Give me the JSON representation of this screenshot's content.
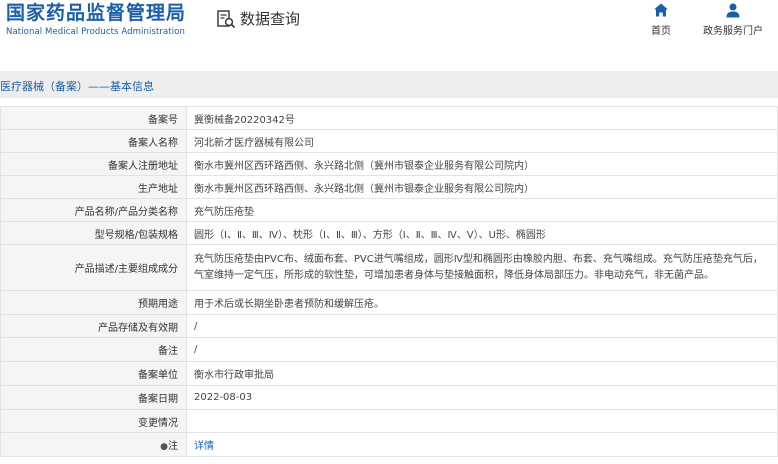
{
  "header": {
    "logo_cn": "国家药品监督管理局",
    "logo_en": "National Medical Products Administration",
    "query_label": "数据查询",
    "nav": [
      {
        "label": "首页",
        "icon": "home-icon"
      },
      {
        "label": "政务服务门户",
        "icon": "user-icon"
      }
    ]
  },
  "section": {
    "title": "医疗器械（备案）——基本信息"
  },
  "rows": [
    {
      "label": "备案号",
      "value": "冀衡械备20220342号"
    },
    {
      "label": "备案人名称",
      "value": "河北新才医疗器械有限公司"
    },
    {
      "label": "备案人注册地址",
      "value": "衡水市冀州区西环路西侧、永兴路北侧（冀州市银泰企业服务有限公司院内）"
    },
    {
      "label": "生产地址",
      "value": "衡水市冀州区西环路西侧、永兴路北侧（冀州市银泰企业服务有限公司院内）"
    },
    {
      "label": "产品名称/产品分类名称",
      "value": "充气防压疮垫"
    },
    {
      "label": "型号规格/包装规格",
      "value": "圆形（Ⅰ、Ⅱ、Ⅲ、Ⅳ）、枕形（Ⅰ、Ⅱ、Ⅲ）、方形（Ⅰ、Ⅱ、Ⅲ、Ⅳ、Ⅴ）、U形、椭圆形"
    },
    {
      "label": "产品描述/主要组成成分",
      "value": "充气防压疮垫由PVC布、绒面布套、PVC进气嘴组成，圆形Ⅳ型和椭圆形由橡胶内胆、布套、充气嘴组成。充气防压疮垫充气后，气室维持一定气压，所形成的软性垫，可增加患者身体与垫接触面积，降低身体局部压力。非电动充气，非无菌产品。"
    },
    {
      "label": "预期用途",
      "value": "用于术后或长期坐卧患者预防和缓解压疮。"
    },
    {
      "label": "产品存储及有效期",
      "value": "/"
    },
    {
      "label": "备注",
      "value": "/"
    },
    {
      "label": "备案单位",
      "value": "衡水市行政审批局"
    },
    {
      "label": "备案日期",
      "value": "2022-08-03"
    },
    {
      "label": "变更情况",
      "value": ""
    }
  ],
  "note_row": {
    "label": "注",
    "link": "详情"
  }
}
